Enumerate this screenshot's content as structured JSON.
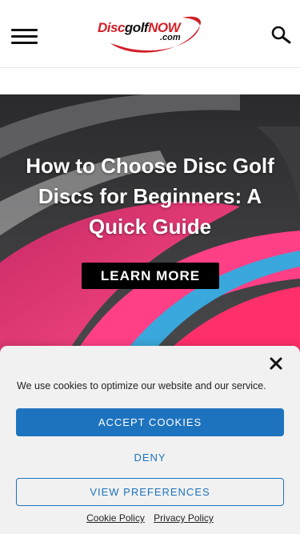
{
  "header": {
    "logo": {
      "part_disc": "Disc",
      "part_golf": "golf",
      "part_now": "NOW",
      "part_com": ".com",
      "color_red": "#d11f26",
      "color_dark": "#111111"
    },
    "menu_icon": "hamburger-icon",
    "search_icon": "search-icon"
  },
  "hero": {
    "title": "How to Choose Disc Golf Discs for Beginners: A Quick Guide",
    "button_label": "LEARN MORE",
    "colors": {
      "pink": "#f0387a",
      "cyan": "#3aa8dc",
      "dark": "#2e2e30"
    }
  },
  "cookie_banner": {
    "close_icon": "close-icon",
    "message": "We use cookies to optimize our website and our service.",
    "accept_label": "ACCEPT COOKIES",
    "deny_label": "DENY",
    "preferences_label": "VIEW PREFERENCES",
    "cookie_policy_link": "Cookie Policy",
    "privacy_policy_link": "Privacy Policy",
    "accent_color": "#1e73be"
  }
}
